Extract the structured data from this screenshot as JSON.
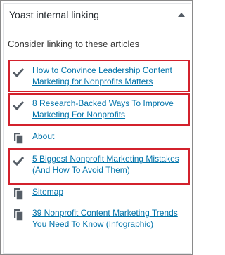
{
  "widget": {
    "title": "Yoast internal linking",
    "toggle_icon": "caret-up-icon",
    "intro": "Consider linking to these articles"
  },
  "links": [
    {
      "label": "How to Convince Leadership Content Marketing for Nonprofits Matters",
      "icon": "checkmark-icon",
      "highlighted": true
    },
    {
      "label": "8 Research-Backed Ways To Improve Marketing For Nonprofits",
      "icon": "checkmark-icon",
      "highlighted": true
    },
    {
      "label": "About",
      "icon": "page-icon",
      "highlighted": false
    },
    {
      "label": "5 Biggest Nonprofit Marketing Mistakes (And How To Avoid Them)",
      "icon": "checkmark-icon",
      "highlighted": true
    },
    {
      "label": "Sitemap",
      "icon": "page-icon",
      "highlighted": false
    },
    {
      "label": "39 Nonprofit Content Marketing Trends You Need To Know (Infographic)",
      "icon": "page-icon",
      "highlighted": false
    }
  ],
  "colors": {
    "link": "#0073aa",
    "highlight_border": "#d3212c",
    "icon": "#555d66"
  }
}
